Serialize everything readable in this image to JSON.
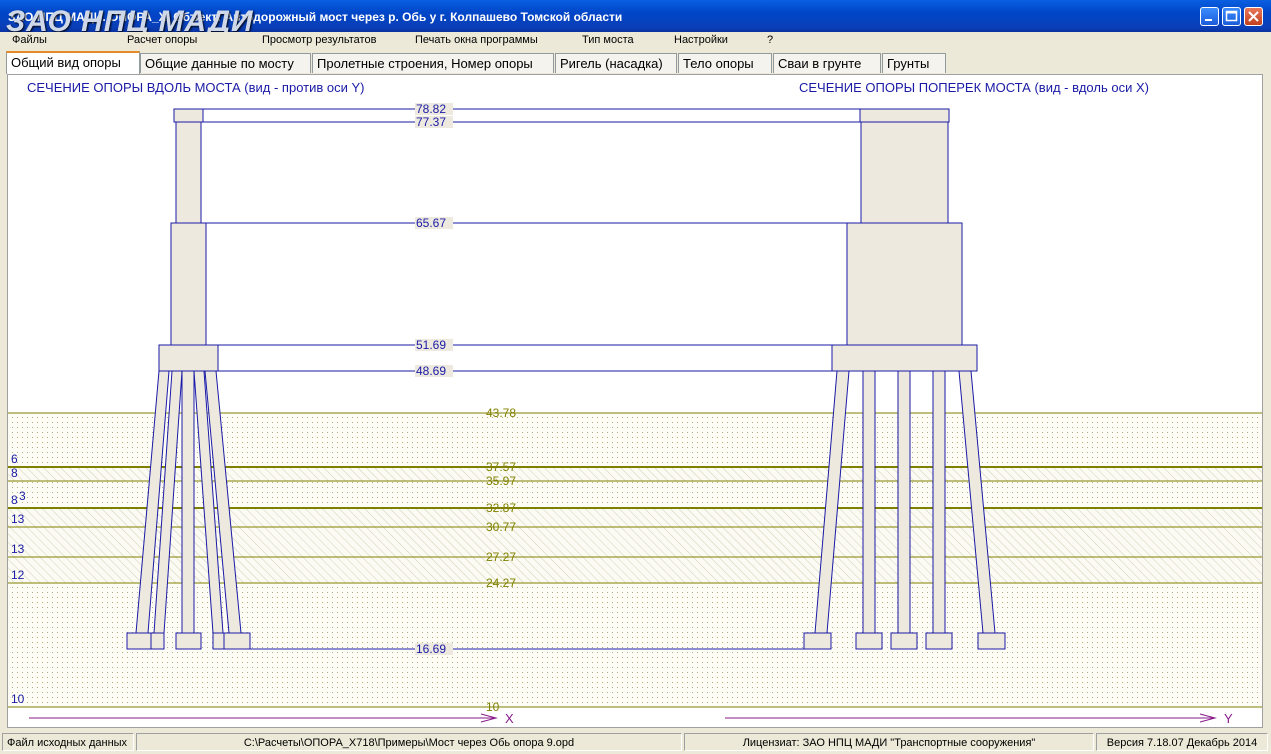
{
  "window": {
    "logo": "ЗАО НПЦ МАДИ",
    "title": "ЗАО НПЦ МАДИ. ОПОРА_X. Объект: Автодорожный мост через р. Обь у г. Колпашево Томской области"
  },
  "menu": [
    "Файлы",
    "Расчет опоры",
    "Просмотр результатов",
    "Печать окна программы",
    "Тип моста",
    "Настройки",
    "?"
  ],
  "tabs": [
    "Общий вид опоры",
    "Общие данные по мосту",
    "Пролетные строения, Номер опоры",
    "Ригель (насадка)",
    "Тело опоры",
    "Сваи в грунте",
    "Грунты"
  ],
  "section": {
    "left_title": "СЕЧЕНИЕ ОПОРЫ ВДОЛЬ МОСТА (вид - против оси Y)",
    "right_title": "СЕЧЕНИЕ ОПОРЫ ПОПЕРЕК МОСТА (вид - вдоль оси X)"
  },
  "levels_structure": [
    "78.82",
    "77.37",
    "65.67",
    "51.69",
    "48.69",
    "16.69"
  ],
  "levels_soil": [
    "43.78",
    "37.57",
    "35.97",
    "32.87",
    "30.77",
    "27.27",
    "24.27",
    "10"
  ],
  "soil_layer_numbers": [
    "6",
    "8",
    "8",
    "3",
    "13",
    "13",
    "12",
    "10"
  ],
  "axes": {
    "x": "X",
    "y": "Y"
  },
  "colors": {
    "structure": "#1a1aa6",
    "soil": "#808000",
    "concrete": "#ede9df"
  },
  "status": {
    "file_label": "Файл исходных данных",
    "file_path": "C:\\Расчеты\\ОПОРА_X718\\Примеры\\Мост через Обь опора 9.opd",
    "licensee": "Лицензиат: ЗАО НПЦ МАДИ \"Транспортные сооружения\"",
    "version": "Версия 7.18.07 Декабрь 2014"
  }
}
